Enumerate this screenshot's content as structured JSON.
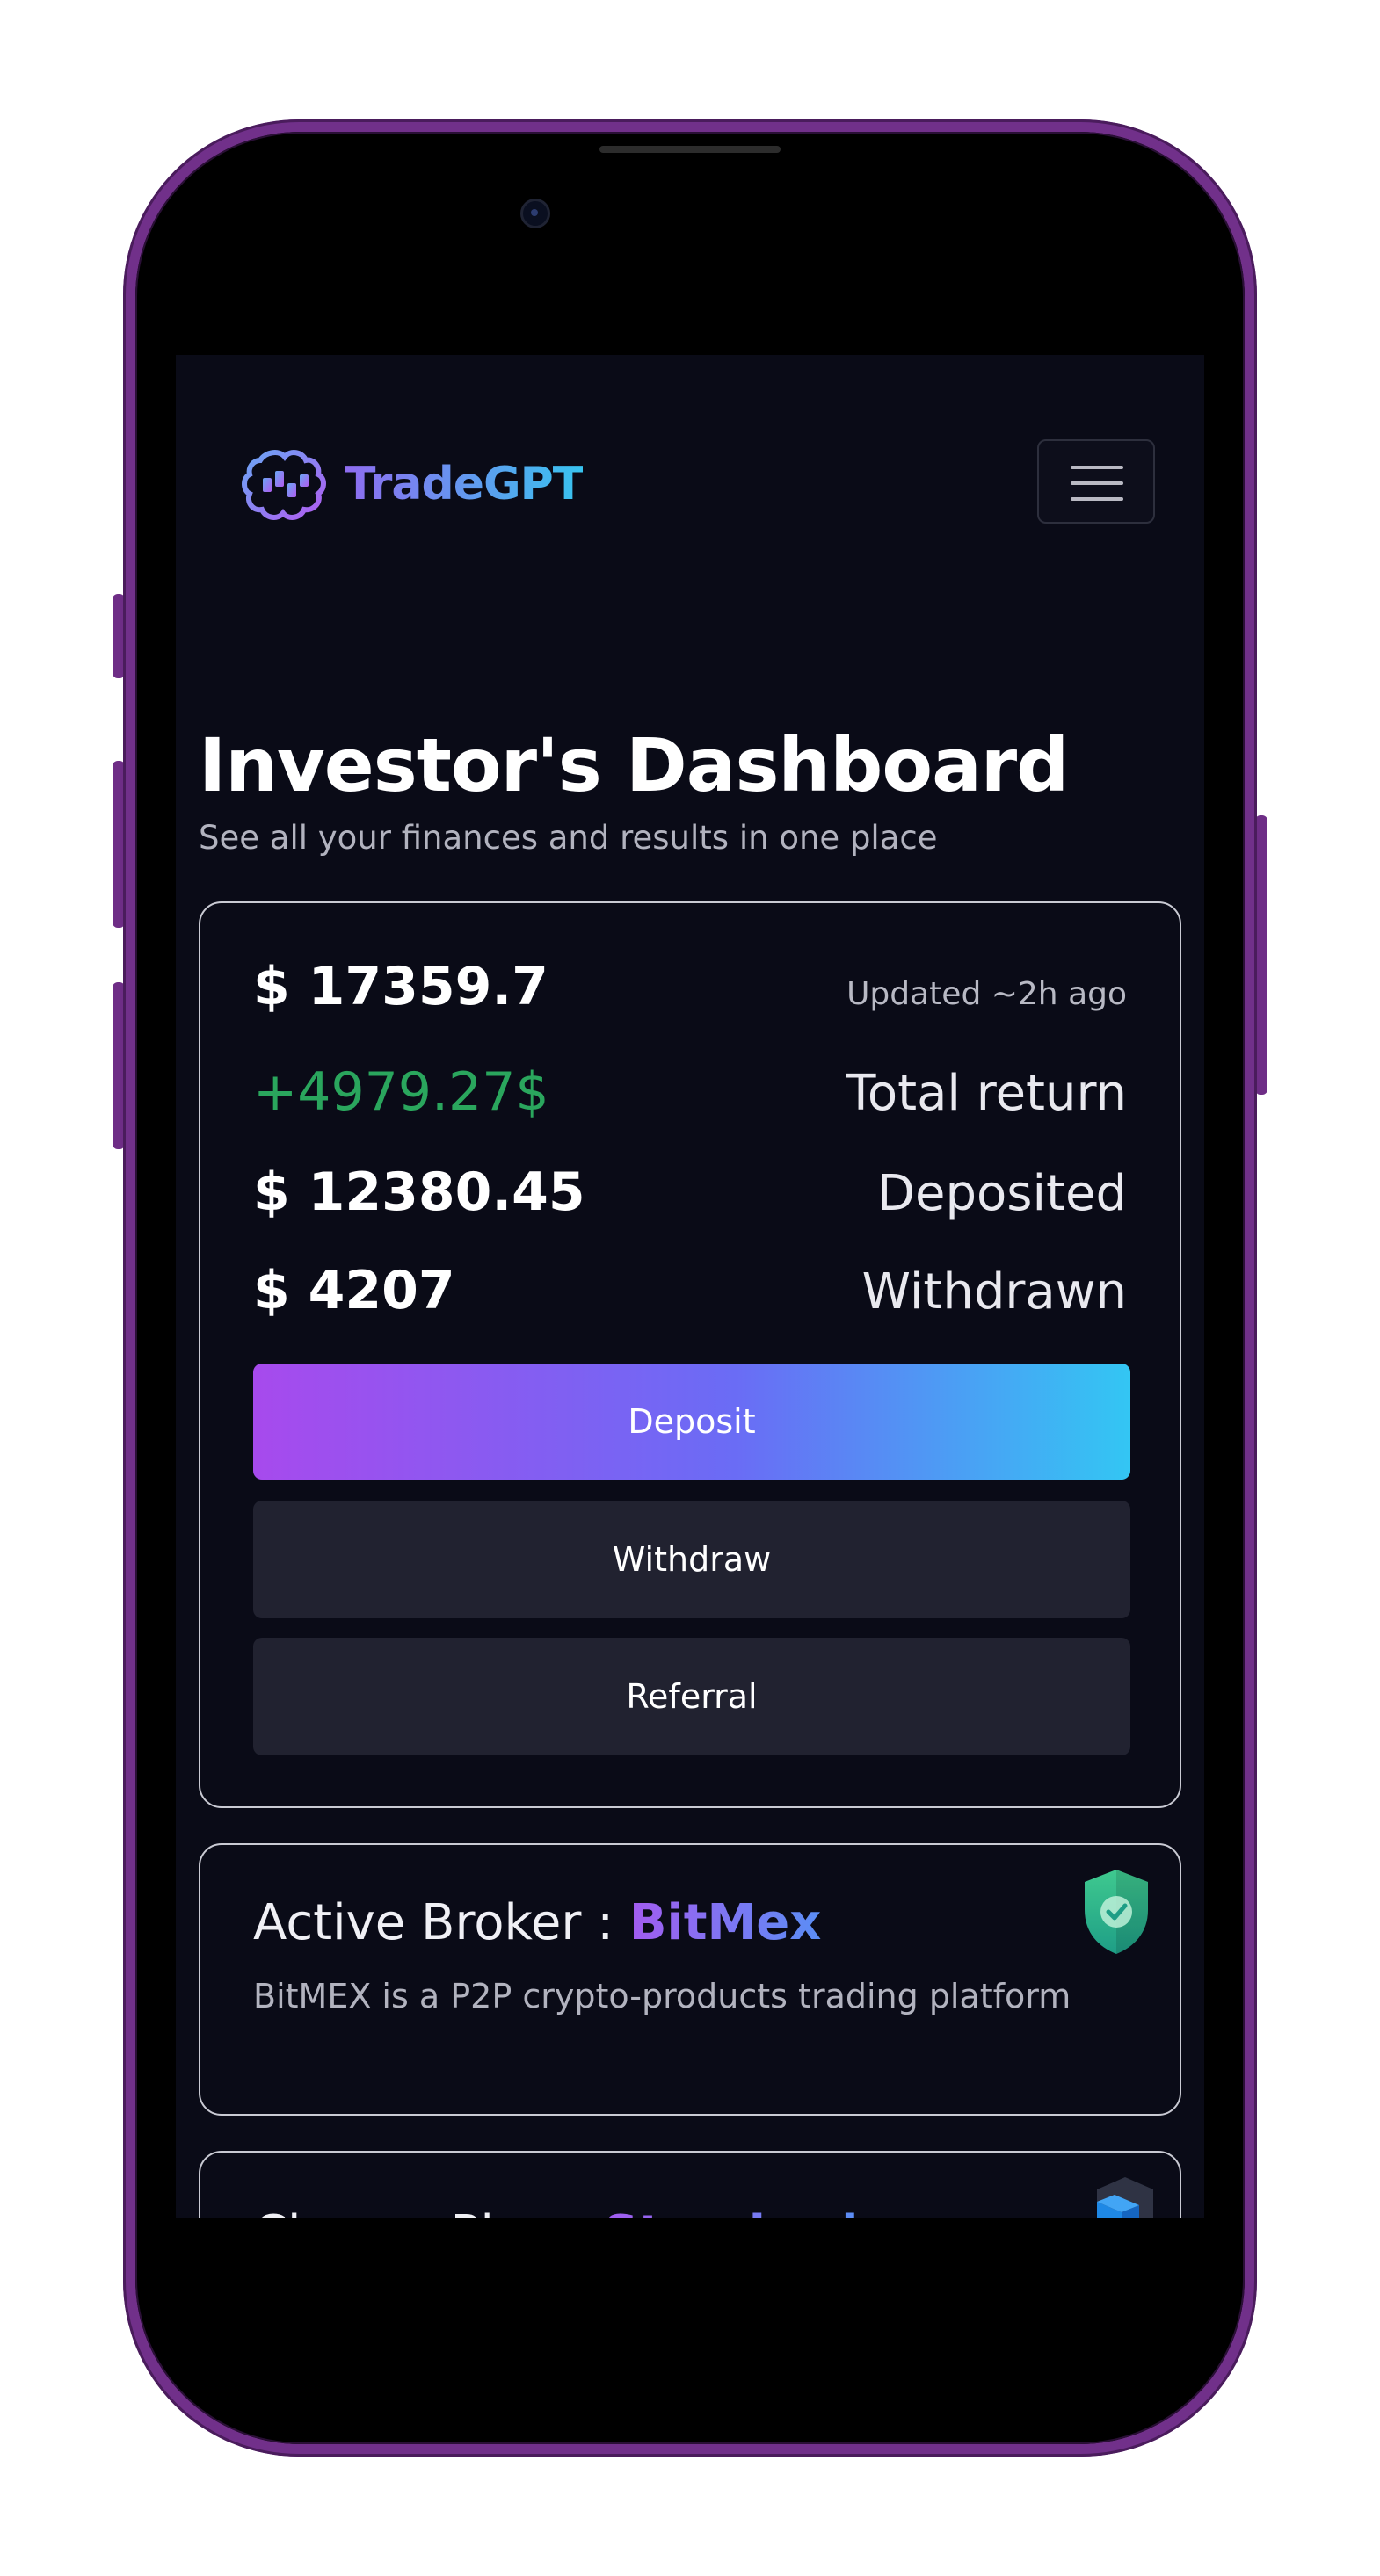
{
  "brand": {
    "name": "TradeGPT",
    "logo_icon": "brain-chart-logo-icon"
  },
  "header": {
    "menu_icon": "hamburger-menu-icon"
  },
  "page": {
    "title": "Investor's Dashboard",
    "subtitle": "See all your finances and results in one place"
  },
  "balance": {
    "total": "$ 17359.7",
    "updated": "Updated ~2h ago",
    "return_value": "+4979.27$",
    "return_label": "Total return",
    "deposited_value": "$ 12380.45",
    "deposited_label": "Deposited",
    "withdrawn_value": "$ 4207",
    "withdrawn_label": "Withdrawn"
  },
  "actions": {
    "deposit": "Deposit",
    "withdraw": "Withdraw",
    "referral": "Referral"
  },
  "broker": {
    "prefix": "Active Broker : ",
    "name": "BitMex",
    "description": "BitMEX is a P2P crypto-products trading platform",
    "icon": "shield-check-icon"
  },
  "plan": {
    "prefix": "Choose Plan : ",
    "name": "Standard",
    "icon": "cube-stack-icon"
  },
  "colors": {
    "background": "#0a0b17",
    "accent_gradient_start": "#a74aed",
    "accent_gradient_end": "#33c6f3",
    "positive": "#2aa65d",
    "phone_frame": "#71308a"
  }
}
